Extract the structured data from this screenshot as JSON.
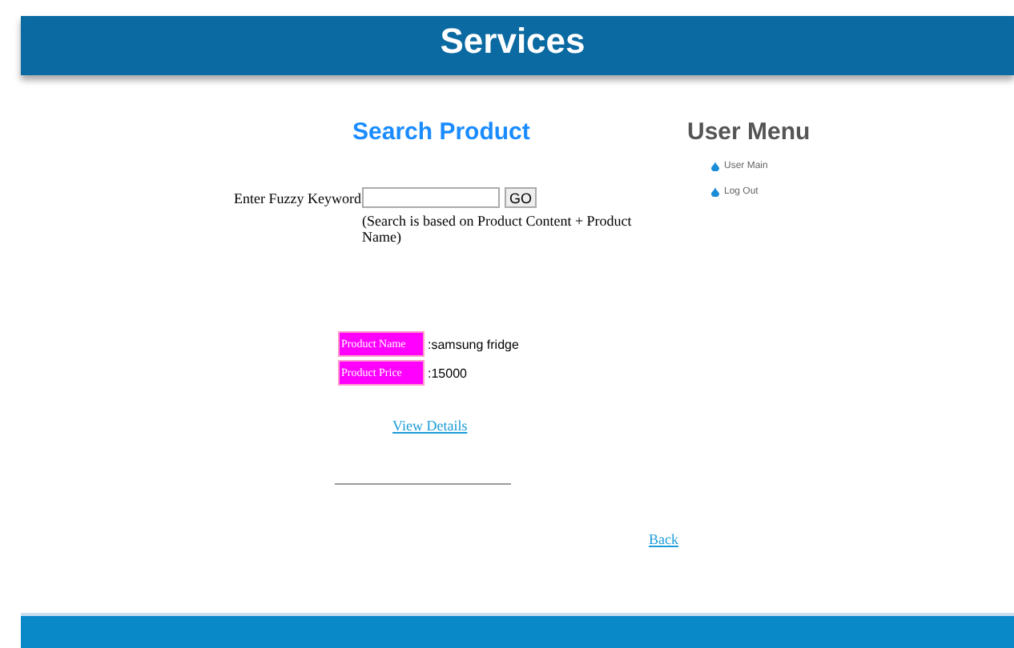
{
  "header": {
    "title": "Services"
  },
  "search": {
    "title": "Search Product",
    "label": "Enter Fuzzy Keyword",
    "button": "GO",
    "note": "(Search is based on Product Content + Product Name)"
  },
  "product": {
    "rows": [
      {
        "label": "Product Name",
        "value": ":samsung fridge"
      },
      {
        "label": "Product Price",
        "value": ":15000"
      }
    ],
    "link": "View Details"
  },
  "back": "Back",
  "user_menu": {
    "title": "User Menu",
    "items": [
      "User Main",
      "Log Out"
    ]
  }
}
